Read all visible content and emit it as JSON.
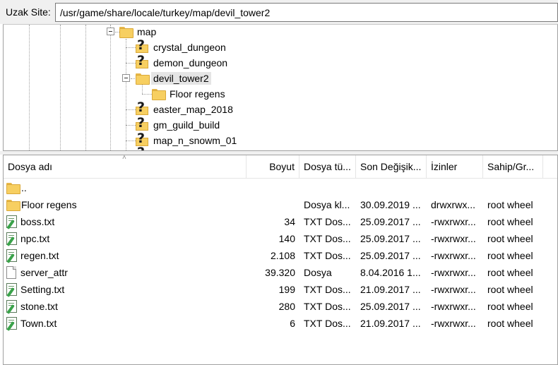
{
  "remote_site": {
    "label": "Uzak Site:",
    "path": "/usr/game/share/locale/turkey/map/devil_tower2"
  },
  "tree": {
    "items": [
      {
        "label": "map",
        "icon": "folder-icon"
      },
      {
        "label": "crystal_dungeon",
        "icon": "unknown-folder-icon"
      },
      {
        "label": "demon_dungeon",
        "icon": "unknown-folder-icon"
      },
      {
        "label": "devil_tower2",
        "icon": "folder-icon",
        "selected": true
      },
      {
        "label": "Floor regens",
        "icon": "folder-icon"
      },
      {
        "label": "easter_map_2018",
        "icon": "unknown-folder-icon"
      },
      {
        "label": "gm_guild_build",
        "icon": "unknown-folder-icon"
      },
      {
        "label": "map_n_snowm_01",
        "icon": "unknown-folder-icon"
      }
    ]
  },
  "list": {
    "columns": {
      "name": "Dosya adı",
      "size": "Boyut",
      "type": "Dosya tü...",
      "modified": "Son Değişik...",
      "perms": "İzinler",
      "owner": "Sahip/Gr..."
    },
    "rows": [
      {
        "name": "..",
        "size": "",
        "type": "",
        "modified": "",
        "perms": "",
        "owner": "",
        "icon": "folder-icon"
      },
      {
        "name": "Floor regens",
        "size": "",
        "type": "Dosya kl...",
        "modified": "30.09.2019 ...",
        "perms": "drwxrwx...",
        "owner": "root wheel",
        "icon": "folder-icon"
      },
      {
        "name": "boss.txt",
        "size": "34",
        "type": "TXT Dos...",
        "modified": "25.09.2017 ...",
        "perms": "-rwxrwxr...",
        "owner": "root wheel",
        "icon": "text-file-icon"
      },
      {
        "name": "npc.txt",
        "size": "140",
        "type": "TXT Dos...",
        "modified": "25.09.2017 ...",
        "perms": "-rwxrwxr...",
        "owner": "root wheel",
        "icon": "text-file-icon"
      },
      {
        "name": "regen.txt",
        "size": "2.108",
        "type": "TXT Dos...",
        "modified": "25.09.2017 ...",
        "perms": "-rwxrwxr...",
        "owner": "root wheel",
        "icon": "text-file-icon"
      },
      {
        "name": "server_attr",
        "size": "39.320",
        "type": "Dosya",
        "modified": "8.04.2016 1...",
        "perms": "-rwxrwxr...",
        "owner": "root wheel",
        "icon": "file-icon"
      },
      {
        "name": "Setting.txt",
        "size": "199",
        "type": "TXT Dos...",
        "modified": "21.09.2017 ...",
        "perms": "-rwxrwxr...",
        "owner": "root wheel",
        "icon": "text-file-icon"
      },
      {
        "name": "stone.txt",
        "size": "280",
        "type": "TXT Dos...",
        "modified": "25.09.2017 ...",
        "perms": "-rwxrwxr...",
        "owner": "root wheel",
        "icon": "text-file-icon"
      },
      {
        "name": "Town.txt",
        "size": "6",
        "type": "TXT Dos...",
        "modified": "21.09.2017 ...",
        "perms": "-rwxrwxr...",
        "owner": "root wheel",
        "icon": "text-file-icon"
      }
    ]
  }
}
